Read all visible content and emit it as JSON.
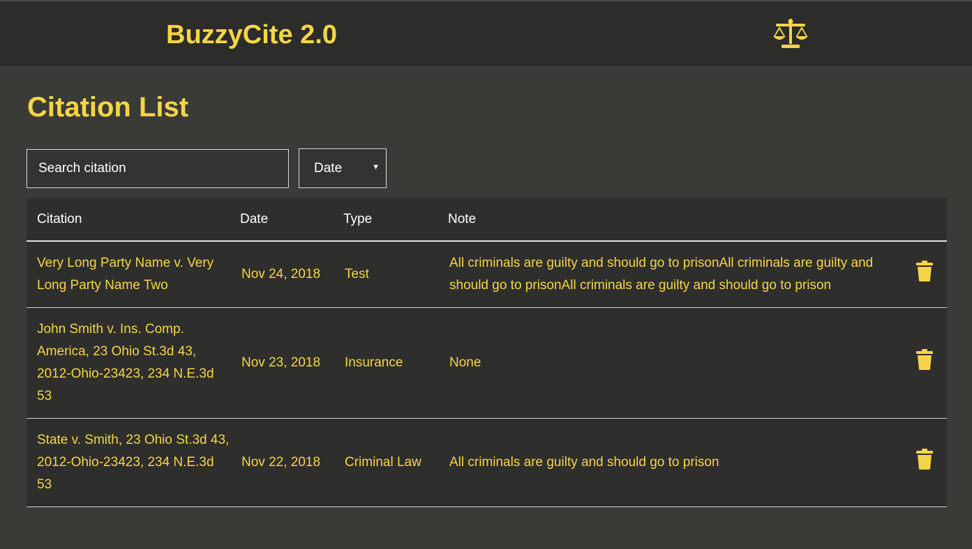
{
  "header": {
    "app_title": "BuzzyCite 2.0",
    "logo_icon": "scale-balance-icon"
  },
  "page": {
    "title": "Citation List"
  },
  "search": {
    "placeholder": "Search citation",
    "value": ""
  },
  "sort": {
    "selected": "Date"
  },
  "table": {
    "columns": [
      "Citation",
      "Date",
      "Type",
      "Note"
    ],
    "rows": [
      {
        "citation": "Very Long Party Name v. Very Long Party Name Two",
        "date": "Nov 24, 2018",
        "type": "Test",
        "note": "All criminals are guilty and should go to prisonAll criminals are guilty and should go to prisonAll criminals are guilty and should go to prison"
      },
      {
        "citation": "John Smith v. Ins. Comp. America, 23 Ohio St.3d 43, 2012-Ohio-23423, 234 N.E.3d 53",
        "date": "Nov 23, 2018",
        "type": "Insurance",
        "note": "None"
      },
      {
        "citation": "State v. Smith, 23 Ohio St.3d 43, 2012-Ohio-23423, 234 N.E.3d 53",
        "date": "Nov 22, 2018",
        "type": "Criminal Law",
        "note": "All criminals are guilty and should go to prison"
      }
    ],
    "row_action_icon": "trash-icon"
  },
  "colors": {
    "accent": "#f5d547",
    "background": "#3a3b37",
    "header_bg": "#2c2c2a",
    "table_bg": "#2e2e2c"
  }
}
